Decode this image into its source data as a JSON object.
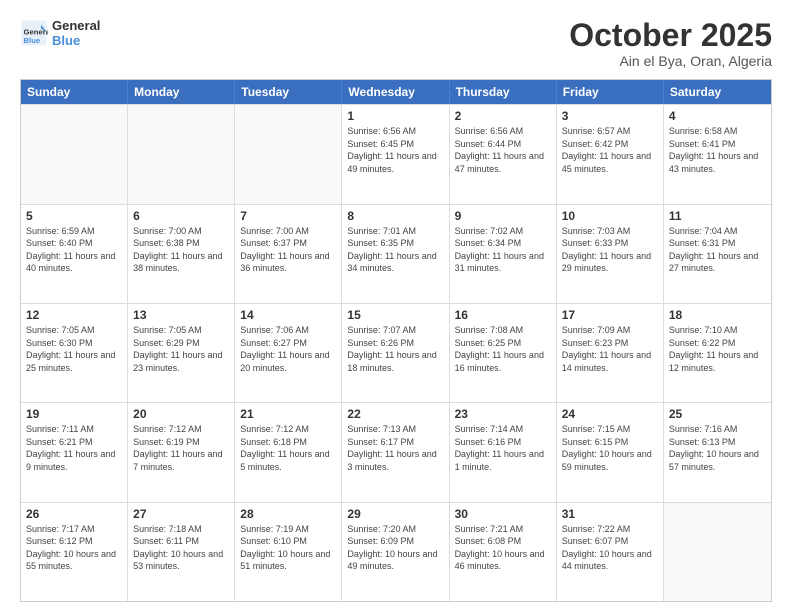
{
  "logo": {
    "line1": "General",
    "line2": "Blue"
  },
  "title": "October 2025",
  "subtitle": "Ain el Bya, Oran, Algeria",
  "days": [
    "Sunday",
    "Monday",
    "Tuesday",
    "Wednesday",
    "Thursday",
    "Friday",
    "Saturday"
  ],
  "weeks": [
    [
      {
        "day": "",
        "text": ""
      },
      {
        "day": "",
        "text": ""
      },
      {
        "day": "",
        "text": ""
      },
      {
        "day": "1",
        "text": "Sunrise: 6:56 AM\nSunset: 6:45 PM\nDaylight: 11 hours and 49 minutes."
      },
      {
        "day": "2",
        "text": "Sunrise: 6:56 AM\nSunset: 6:44 PM\nDaylight: 11 hours and 47 minutes."
      },
      {
        "day": "3",
        "text": "Sunrise: 6:57 AM\nSunset: 6:42 PM\nDaylight: 11 hours and 45 minutes."
      },
      {
        "day": "4",
        "text": "Sunrise: 6:58 AM\nSunset: 6:41 PM\nDaylight: 11 hours and 43 minutes."
      }
    ],
    [
      {
        "day": "5",
        "text": "Sunrise: 6:59 AM\nSunset: 6:40 PM\nDaylight: 11 hours and 40 minutes."
      },
      {
        "day": "6",
        "text": "Sunrise: 7:00 AM\nSunset: 6:38 PM\nDaylight: 11 hours and 38 minutes."
      },
      {
        "day": "7",
        "text": "Sunrise: 7:00 AM\nSunset: 6:37 PM\nDaylight: 11 hours and 36 minutes."
      },
      {
        "day": "8",
        "text": "Sunrise: 7:01 AM\nSunset: 6:35 PM\nDaylight: 11 hours and 34 minutes."
      },
      {
        "day": "9",
        "text": "Sunrise: 7:02 AM\nSunset: 6:34 PM\nDaylight: 11 hours and 31 minutes."
      },
      {
        "day": "10",
        "text": "Sunrise: 7:03 AM\nSunset: 6:33 PM\nDaylight: 11 hours and 29 minutes."
      },
      {
        "day": "11",
        "text": "Sunrise: 7:04 AM\nSunset: 6:31 PM\nDaylight: 11 hours and 27 minutes."
      }
    ],
    [
      {
        "day": "12",
        "text": "Sunrise: 7:05 AM\nSunset: 6:30 PM\nDaylight: 11 hours and 25 minutes."
      },
      {
        "day": "13",
        "text": "Sunrise: 7:05 AM\nSunset: 6:29 PM\nDaylight: 11 hours and 23 minutes."
      },
      {
        "day": "14",
        "text": "Sunrise: 7:06 AM\nSunset: 6:27 PM\nDaylight: 11 hours and 20 minutes."
      },
      {
        "day": "15",
        "text": "Sunrise: 7:07 AM\nSunset: 6:26 PM\nDaylight: 11 hours and 18 minutes."
      },
      {
        "day": "16",
        "text": "Sunrise: 7:08 AM\nSunset: 6:25 PM\nDaylight: 11 hours and 16 minutes."
      },
      {
        "day": "17",
        "text": "Sunrise: 7:09 AM\nSunset: 6:23 PM\nDaylight: 11 hours and 14 minutes."
      },
      {
        "day": "18",
        "text": "Sunrise: 7:10 AM\nSunset: 6:22 PM\nDaylight: 11 hours and 12 minutes."
      }
    ],
    [
      {
        "day": "19",
        "text": "Sunrise: 7:11 AM\nSunset: 6:21 PM\nDaylight: 11 hours and 9 minutes."
      },
      {
        "day": "20",
        "text": "Sunrise: 7:12 AM\nSunset: 6:19 PM\nDaylight: 11 hours and 7 minutes."
      },
      {
        "day": "21",
        "text": "Sunrise: 7:12 AM\nSunset: 6:18 PM\nDaylight: 11 hours and 5 minutes."
      },
      {
        "day": "22",
        "text": "Sunrise: 7:13 AM\nSunset: 6:17 PM\nDaylight: 11 hours and 3 minutes."
      },
      {
        "day": "23",
        "text": "Sunrise: 7:14 AM\nSunset: 6:16 PM\nDaylight: 11 hours and 1 minute."
      },
      {
        "day": "24",
        "text": "Sunrise: 7:15 AM\nSunset: 6:15 PM\nDaylight: 10 hours and 59 minutes."
      },
      {
        "day": "25",
        "text": "Sunrise: 7:16 AM\nSunset: 6:13 PM\nDaylight: 10 hours and 57 minutes."
      }
    ],
    [
      {
        "day": "26",
        "text": "Sunrise: 7:17 AM\nSunset: 6:12 PM\nDaylight: 10 hours and 55 minutes."
      },
      {
        "day": "27",
        "text": "Sunrise: 7:18 AM\nSunset: 6:11 PM\nDaylight: 10 hours and 53 minutes."
      },
      {
        "day": "28",
        "text": "Sunrise: 7:19 AM\nSunset: 6:10 PM\nDaylight: 10 hours and 51 minutes."
      },
      {
        "day": "29",
        "text": "Sunrise: 7:20 AM\nSunset: 6:09 PM\nDaylight: 10 hours and 49 minutes."
      },
      {
        "day": "30",
        "text": "Sunrise: 7:21 AM\nSunset: 6:08 PM\nDaylight: 10 hours and 46 minutes."
      },
      {
        "day": "31",
        "text": "Sunrise: 7:22 AM\nSunset: 6:07 PM\nDaylight: 10 hours and 44 minutes."
      },
      {
        "day": "",
        "text": ""
      }
    ]
  ]
}
